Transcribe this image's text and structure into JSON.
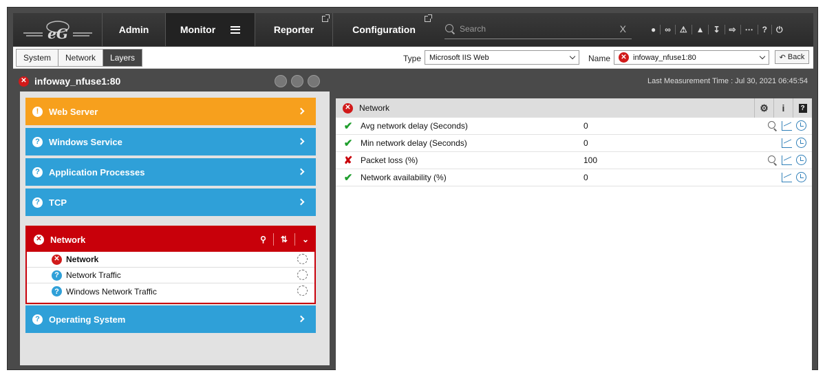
{
  "nav": {
    "logo_text": "eG",
    "admin": "Admin",
    "monitor": "Monitor",
    "reporter": "Reporter",
    "configuration": "Configuration",
    "search_placeholder": "Search",
    "search_clear": "X"
  },
  "tabs": [
    {
      "label": "System"
    },
    {
      "label": "Network"
    },
    {
      "label": "Layers"
    }
  ],
  "selectors": {
    "type_label": "Type",
    "type_value": "Microsoft IIS Web",
    "name_label": "Name",
    "name_value": "infoway_nfuse1:80",
    "back_label": "Back"
  },
  "header": {
    "component_name": "infoway_nfuse1:80",
    "last_measurement": "Last Measurement Time : Jul 30, 2021 06:45:54"
  },
  "layers": [
    {
      "label": "Web Server",
      "status": "warning"
    },
    {
      "label": "Windows Service",
      "status": "unknown"
    },
    {
      "label": "Application Processes",
      "status": "unknown"
    },
    {
      "label": "TCP",
      "status": "unknown"
    },
    {
      "label": "Network",
      "status": "critical"
    },
    {
      "label": "Operating System",
      "status": "unknown"
    }
  ],
  "network_tests": [
    {
      "label": "Network",
      "status": "critical"
    },
    {
      "label": "Network Traffic",
      "status": "unknown"
    },
    {
      "label": "Windows Network Traffic",
      "status": "unknown"
    }
  ],
  "detail": {
    "title": "Network",
    "info_label": "i",
    "help_label": "?",
    "measures": [
      {
        "name": "Avg network delay (Seconds)",
        "value": "0",
        "status": "ok"
      },
      {
        "name": "Min network delay (Seconds)",
        "value": "0",
        "status": "ok"
      },
      {
        "name": "Packet loss (%)",
        "value": "100",
        "status": "bad"
      },
      {
        "name": "Network availability (%)",
        "value": "0",
        "status": "ok"
      }
    ]
  },
  "colors": {
    "warning": "#f7a01d",
    "unknown": "#2fa0d8",
    "critical": "#c8000a",
    "ok": "#1f9e2d"
  }
}
